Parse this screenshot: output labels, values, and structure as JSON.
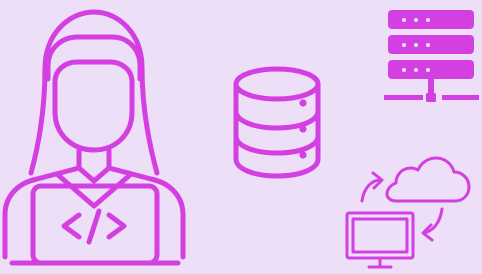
{
  "scene": {
    "developer_icon": "developer-icon",
    "code_icon": "code-icon",
    "database_icon": "database-icon",
    "server_icon": "server-icon",
    "cloud_sync_icon": "cloud-sync-icon",
    "colors": {
      "background": "#ecdff7",
      "accent": "#d33fe0"
    }
  }
}
